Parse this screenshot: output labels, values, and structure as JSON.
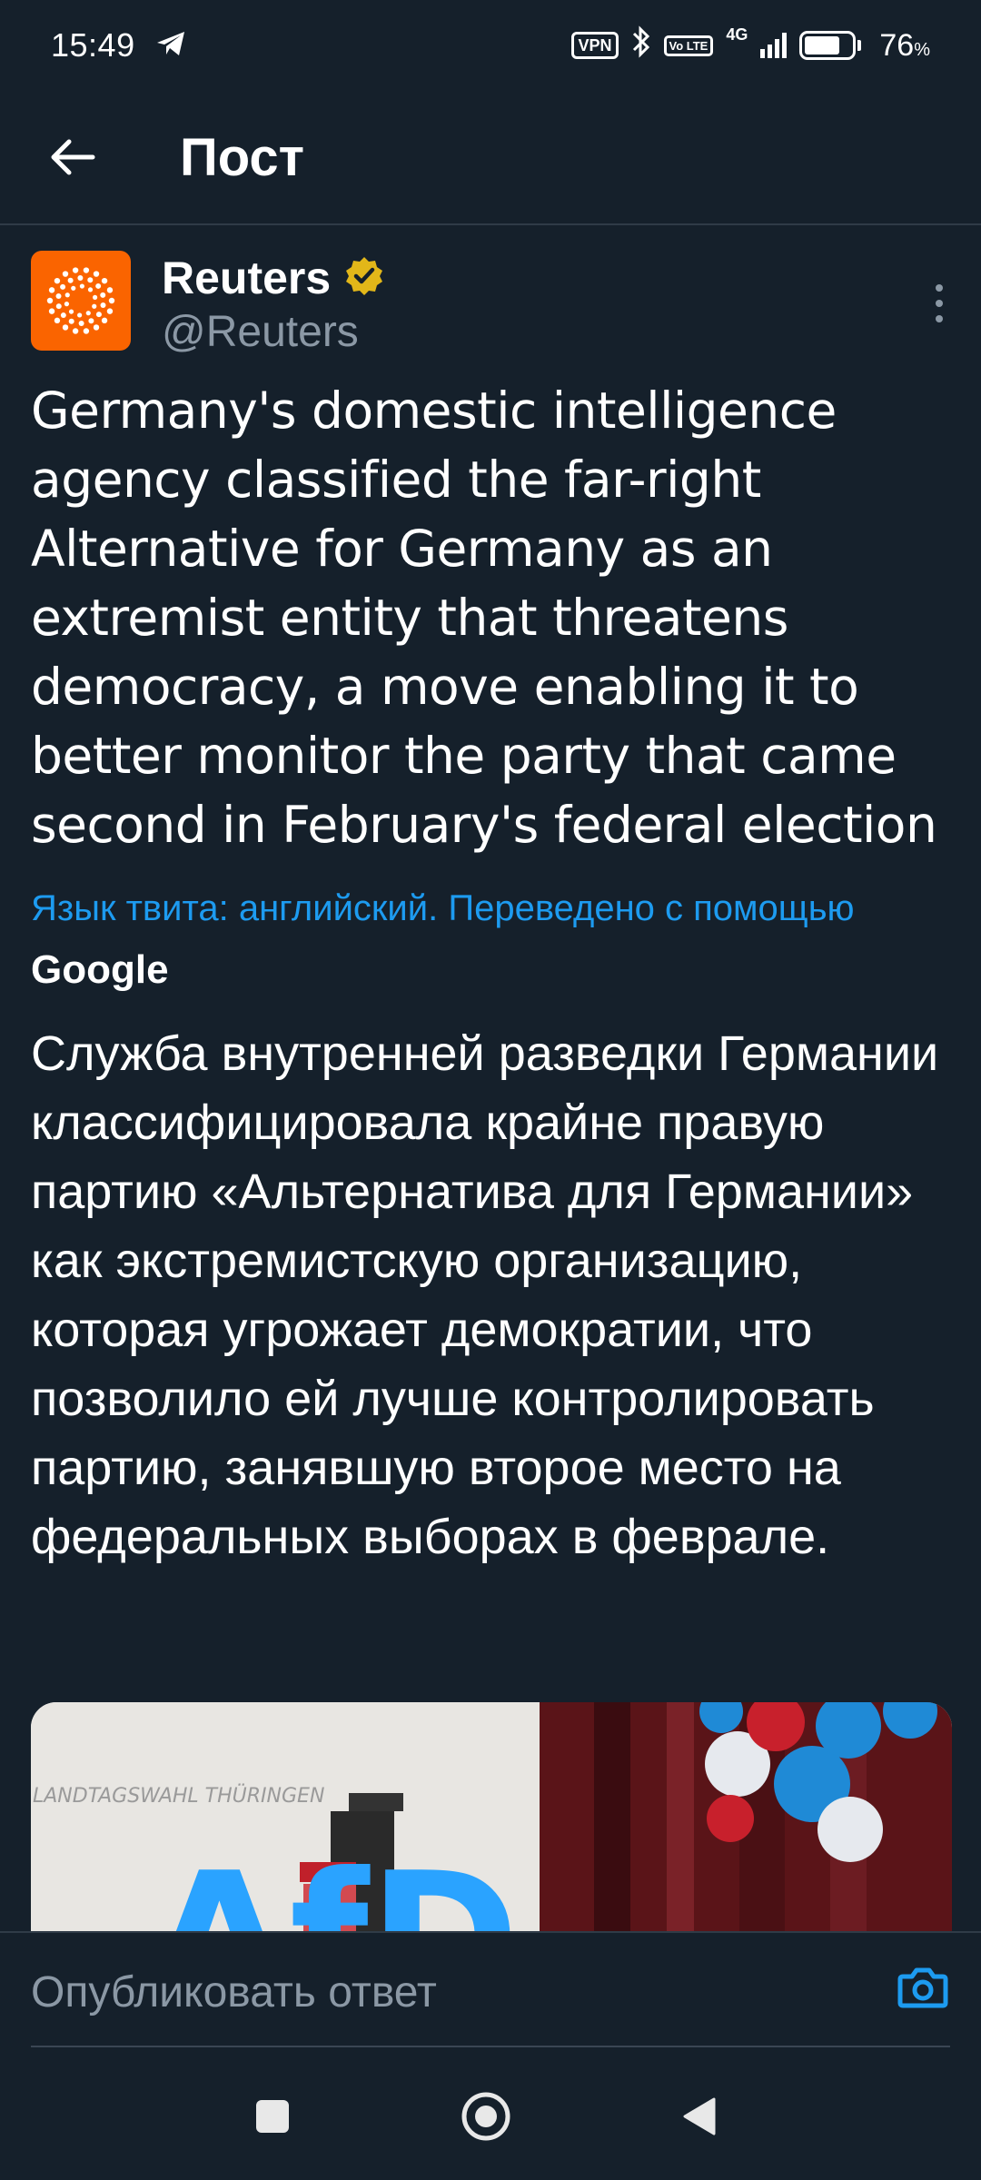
{
  "status_bar": {
    "time": "15:49",
    "vpn": "VPN",
    "lte": "Vo LTE",
    "network": "4G",
    "battery_percent": 76,
    "battery_label": "76",
    "battery_unit": "%"
  },
  "header": {
    "title": "Пост"
  },
  "author": {
    "name": "Reuters",
    "handle": "@Reuters",
    "verified": true,
    "avatar_color": "#fa6400"
  },
  "tweet": {
    "text": "Germany's domestic intelligence agency classified the far-right Alternative for Germany as an extremist entity that threatens democracy, a move enabling it to better monitor the party that came second in February's federal election",
    "translate_note": "Язык твита: английский. Переведено с помощью",
    "translate_provider": "Google",
    "translated_text": "Служба внутренней разведки Германии классифицировала крайне правую партию «Альтернатива для Германии» как экстремистскую организацию, которая угрожает демократии, что позволило ей лучше контролировать партию, занявшую второе место на федеральных выборах в феврале."
  },
  "media": {
    "sign_text": "LANDTAGSWAHL THÜRINGEN",
    "logo_text": "AfD"
  },
  "reply": {
    "placeholder": "Опубликовать ответ"
  },
  "colors": {
    "background": "#15202b",
    "accent": "#1d9bf0",
    "secondary_text": "#8b98a5",
    "verified_badge": "#e2b719"
  },
  "icons": {
    "back": "arrow-left-icon",
    "more": "more-vertical-icon",
    "verified": "verified-badge-icon",
    "camera": "camera-icon",
    "nav_recents": "square-icon",
    "nav_home": "circle-icon",
    "nav_back": "triangle-back-icon"
  }
}
